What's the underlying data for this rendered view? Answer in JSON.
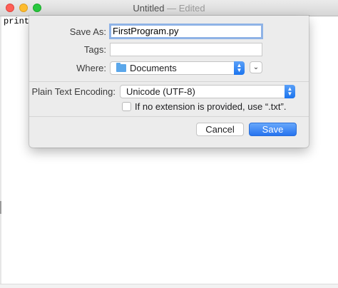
{
  "window": {
    "title": "Untitled",
    "title_suffix": " — Edited",
    "editor_text": "print("
  },
  "dialog": {
    "save_as_label": "Save As:",
    "save_as_value": "FirstProgram.py",
    "tags_label": "Tags:",
    "tags_value": "",
    "where_label": "Where:",
    "where_value": "Documents",
    "where_icon": "folder-icon",
    "encoding_label": "Plain Text Encoding:",
    "encoding_value": "Unicode (UTF-8)",
    "extension_checkbox_label": "If no extension is provided, use “.txt”.",
    "extension_checked": false,
    "cancel_label": "Cancel",
    "save_label": "Save"
  },
  "colors": {
    "accent": "#2673ef",
    "focus_ring": "#8fb3e6",
    "sheet_bg": "#ececec"
  }
}
